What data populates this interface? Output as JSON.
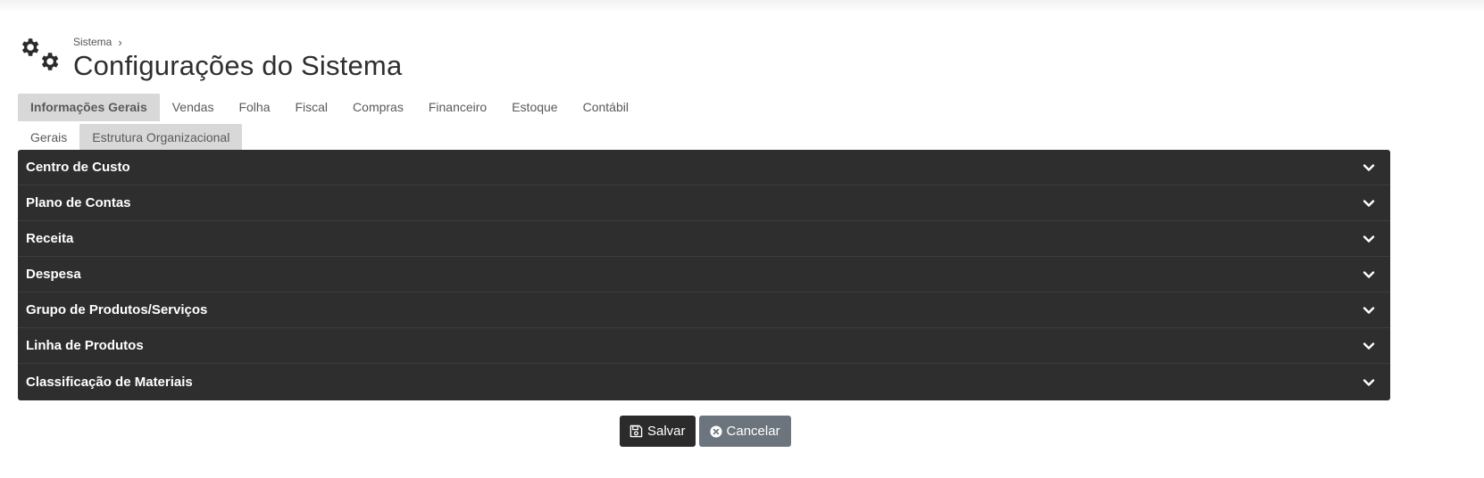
{
  "header": {
    "breadcrumb": "Sistema",
    "breadcrumb_separator": "›",
    "title": "Configurações do Sistema",
    "icon": "gears-icon"
  },
  "main_tabs": [
    {
      "label": "Informações Gerais",
      "active": true
    },
    {
      "label": "Vendas",
      "active": false
    },
    {
      "label": "Folha",
      "active": false
    },
    {
      "label": "Fiscal",
      "active": false
    },
    {
      "label": "Compras",
      "active": false
    },
    {
      "label": "Financeiro",
      "active": false
    },
    {
      "label": "Estoque",
      "active": false
    },
    {
      "label": "Contábil",
      "active": false
    }
  ],
  "sub_tabs": [
    {
      "label": "Gerais",
      "active": false
    },
    {
      "label": "Estrutura Organizacional",
      "active": true
    }
  ],
  "sections": [
    {
      "label": "Centro de Custo"
    },
    {
      "label": "Plano de Contas"
    },
    {
      "label": "Receita"
    },
    {
      "label": "Despesa"
    },
    {
      "label": "Grupo de Produtos/Serviços"
    },
    {
      "label": "Linha de Produtos"
    },
    {
      "label": "Classificação de Materiais"
    }
  ],
  "actions": {
    "save_label": "Salvar",
    "cancel_label": "Cancelar",
    "save_icon": "floppy-disk-icon",
    "cancel_icon": "times-circle-icon"
  },
  "colors": {
    "accordion_bg": "#2e2e2e",
    "active_tab_bg": "#d8d8d8",
    "save_button_bg": "#2b2b2b",
    "cancel_button_bg": "#6c757d"
  }
}
